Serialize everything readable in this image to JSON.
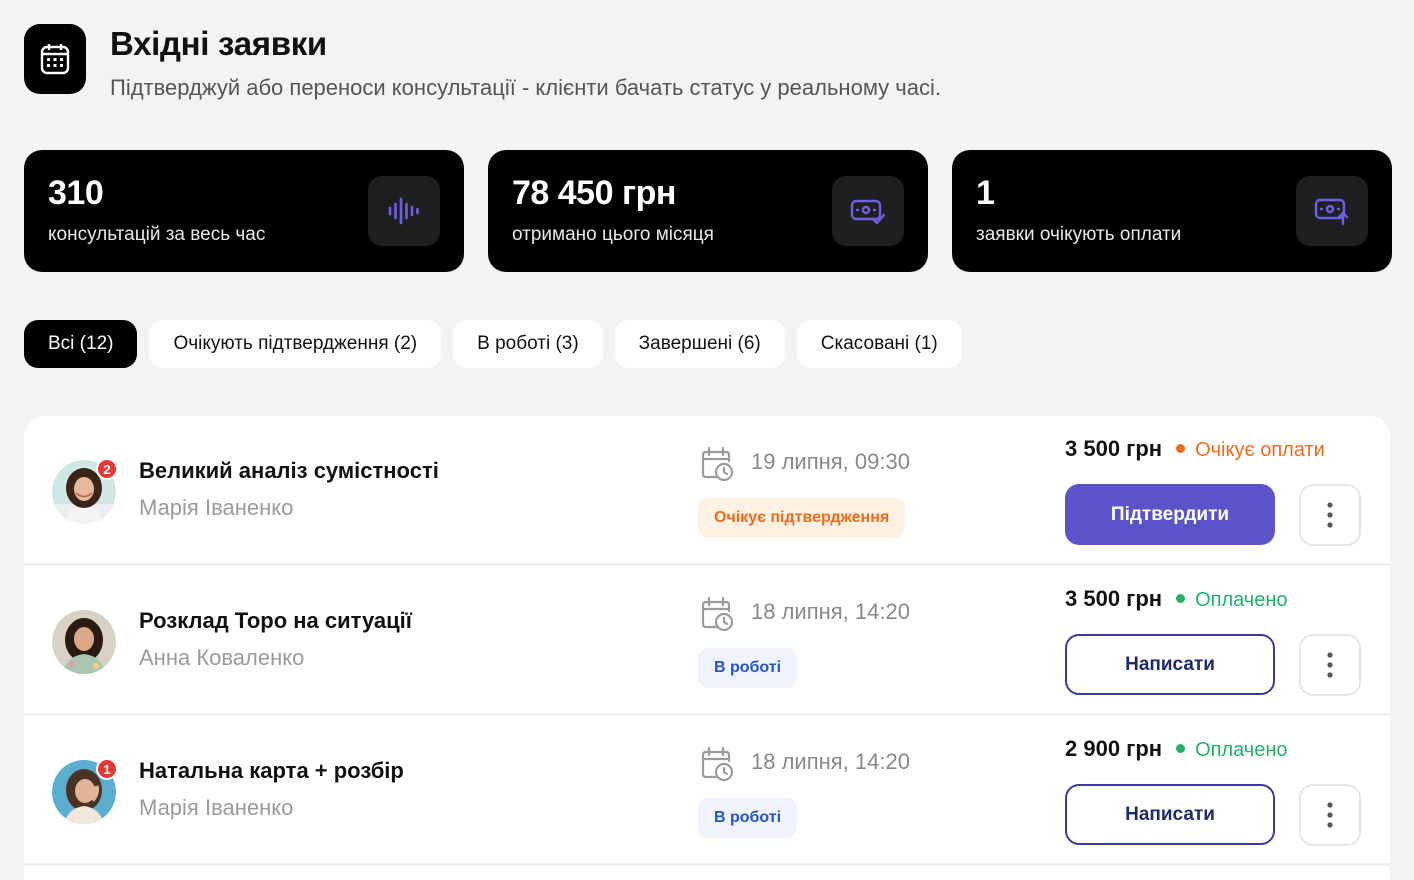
{
  "header": {
    "title": "Вхідні заявки",
    "subtitle": "Підтверджуй або переноси консультації - клієнти бачать статус у реальному часі.",
    "icon": "calendar-icon"
  },
  "stats": [
    {
      "value": "310",
      "label": "консультацій за весь час",
      "icon": "sound-wave-icon"
    },
    {
      "value": "78 450 грн",
      "label": "отримано цього місяця",
      "icon": "money-check-icon"
    },
    {
      "value": "1",
      "label": "заявки очікують оплати",
      "icon": "money-upload-icon"
    }
  ],
  "tabs": [
    {
      "label": "Всі (12)",
      "active": true
    },
    {
      "label": "Очікують підтвердження (2)",
      "active": false
    },
    {
      "label": "В роботі (3)",
      "active": false
    },
    {
      "label": "Завершені (6)",
      "active": false
    },
    {
      "label": "Скасовані (1)",
      "active": false
    }
  ],
  "rows": [
    {
      "title": "Великий аналіз сумістності",
      "client": "Марія Іваненко",
      "badge": "2",
      "date": "19 липня, 09:30",
      "status": "Очікує підтвердження",
      "price": "3 500 грн",
      "payment_status": "Очікує оплати",
      "action": "Підтвердити"
    },
    {
      "title": "Розклад Торо на ситуації",
      "client": "Анна Коваленко",
      "badge": "",
      "date": "18 липня, 14:20",
      "status": "В роботі",
      "price": "3 500 грн",
      "payment_status": "Оплачено",
      "action": "Написати"
    },
    {
      "title": "Натальна карта + розбір",
      "client": "Марія Іваненко",
      "badge": "1",
      "date": "18 липня, 14:20",
      "status": "В роботі",
      "price": "2 900 грн",
      "payment_status": "Оплачено",
      "action": "Написати"
    }
  ],
  "colors": {
    "accent": "#5b53c7",
    "pending": "#ef6c1a",
    "paid": "#22b26b",
    "work": "#2752c9"
  }
}
